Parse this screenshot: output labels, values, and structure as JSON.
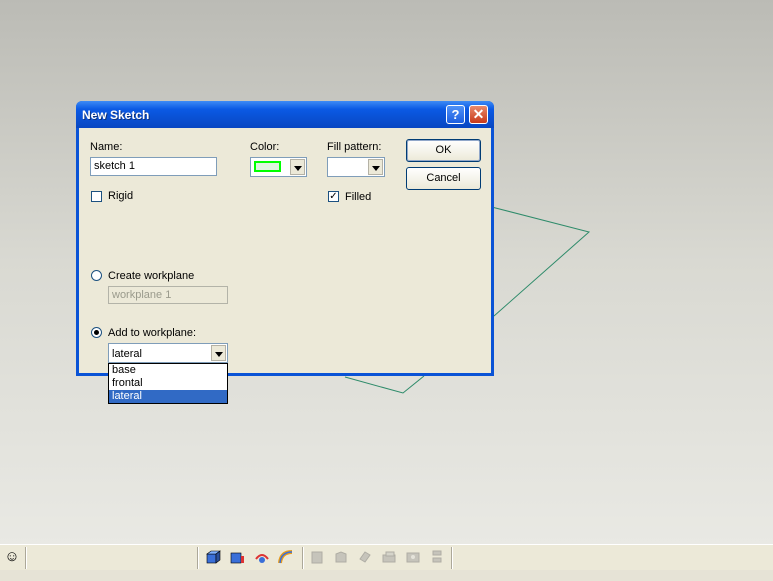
{
  "dialog": {
    "title": "New Sketch",
    "help_glyph": "?",
    "close_glyph": "✕",
    "name_label": "Name:",
    "name_value": "sketch 1",
    "color_label": "Color:",
    "color_value": "#00ff00",
    "fill_pattern_label": "Fill pattern:",
    "ok_label": "OK",
    "cancel_label": "Cancel",
    "rigid_label": "Rigid",
    "rigid_checked": false,
    "filled_label": "Filled",
    "filled_checked": true,
    "create_workplane_label": "Create workplane",
    "workplane_placeholder": "workplane 1",
    "add_to_workplane_label": "Add to workplane:",
    "add_to_workplane_value": "lateral",
    "workplane_options": [
      "base",
      "frontal",
      "lateral"
    ],
    "selected_option": "lateral"
  },
  "statusbar": {
    "smiley_glyph": "☺"
  },
  "colors": {
    "title_bar": "#0a53d6",
    "selection": "#316ac5",
    "sketch_line": "#2e8b6a"
  }
}
